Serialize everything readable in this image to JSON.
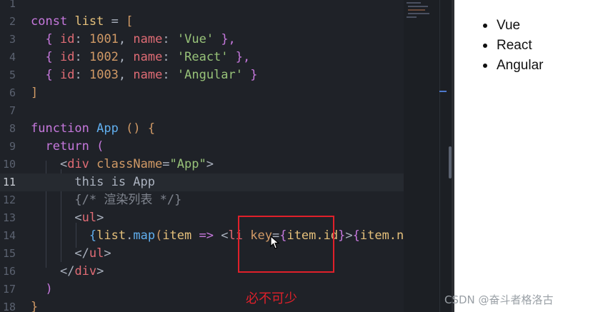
{
  "editor": {
    "line_numbers": [
      "1",
      "2",
      "3",
      "4",
      "5",
      "6",
      "7",
      "8",
      "9",
      "10",
      "11",
      "12",
      "13",
      "14",
      "15",
      "16",
      "17",
      "18"
    ],
    "lines": {
      "l2": {
        "kw": "const",
        "name": "list",
        "op": "=",
        "open": "["
      },
      "l3": {
        "open": "{",
        "k1": "id",
        "v1": "1001",
        "k2": "name",
        "v2": "'Vue'",
        "close": "},"
      },
      "l4": {
        "open": "{",
        "k1": "id",
        "v1": "1002",
        "k2": "name",
        "v2": "'React'",
        "close": "},"
      },
      "l5": {
        "open": "{",
        "k1": "id",
        "v1": "1003",
        "k2": "name",
        "v2": "'Angular'",
        "close": "}"
      },
      "l6": {
        "close": "]"
      },
      "l8": {
        "kw": "function",
        "name": "App",
        "parens": "()",
        "open": "{"
      },
      "l9": {
        "kw": "return",
        "open": "("
      },
      "l10": {
        "lt": "<",
        "tag": "div",
        "attr": "className",
        "eq": "=",
        "val": "\"App\"",
        "gt": ">"
      },
      "l11": {
        "text": "this is App"
      },
      "l12": {
        "comment": "{/* 渲染列表 */}"
      },
      "l13": {
        "lt": "<",
        "tag": "ul",
        "gt": ">"
      },
      "l14": {
        "open": "{",
        "obj": "list",
        "dot": ".",
        "method": "map",
        "paren": "(",
        "param": "item",
        "arrow": "=>",
        "lt": "<",
        "tag": "li",
        "attr": "key",
        "eq": "=",
        "exp_open": "{",
        "exp": "item.id",
        "exp_close": "}",
        "gt": ">",
        "tail_open": "{",
        "tail": "item.nam"
      },
      "l15": {
        "close": "</",
        "tag": "ul",
        "gt": ">"
      },
      "l16": {
        "close": "</",
        "tag": "div",
        "gt": ">"
      },
      "l17": {
        "close": ")"
      },
      "l18": {
        "close": "}"
      }
    }
  },
  "preview": {
    "items": [
      "Vue",
      "React",
      "Angular"
    ]
  },
  "annotation": {
    "text": "必不可少"
  },
  "watermark": {
    "text": "CSDN @奋斗者格洛古"
  },
  "colors": {
    "highlight": "#e0202a",
    "editor_bg": "#1f2228"
  }
}
